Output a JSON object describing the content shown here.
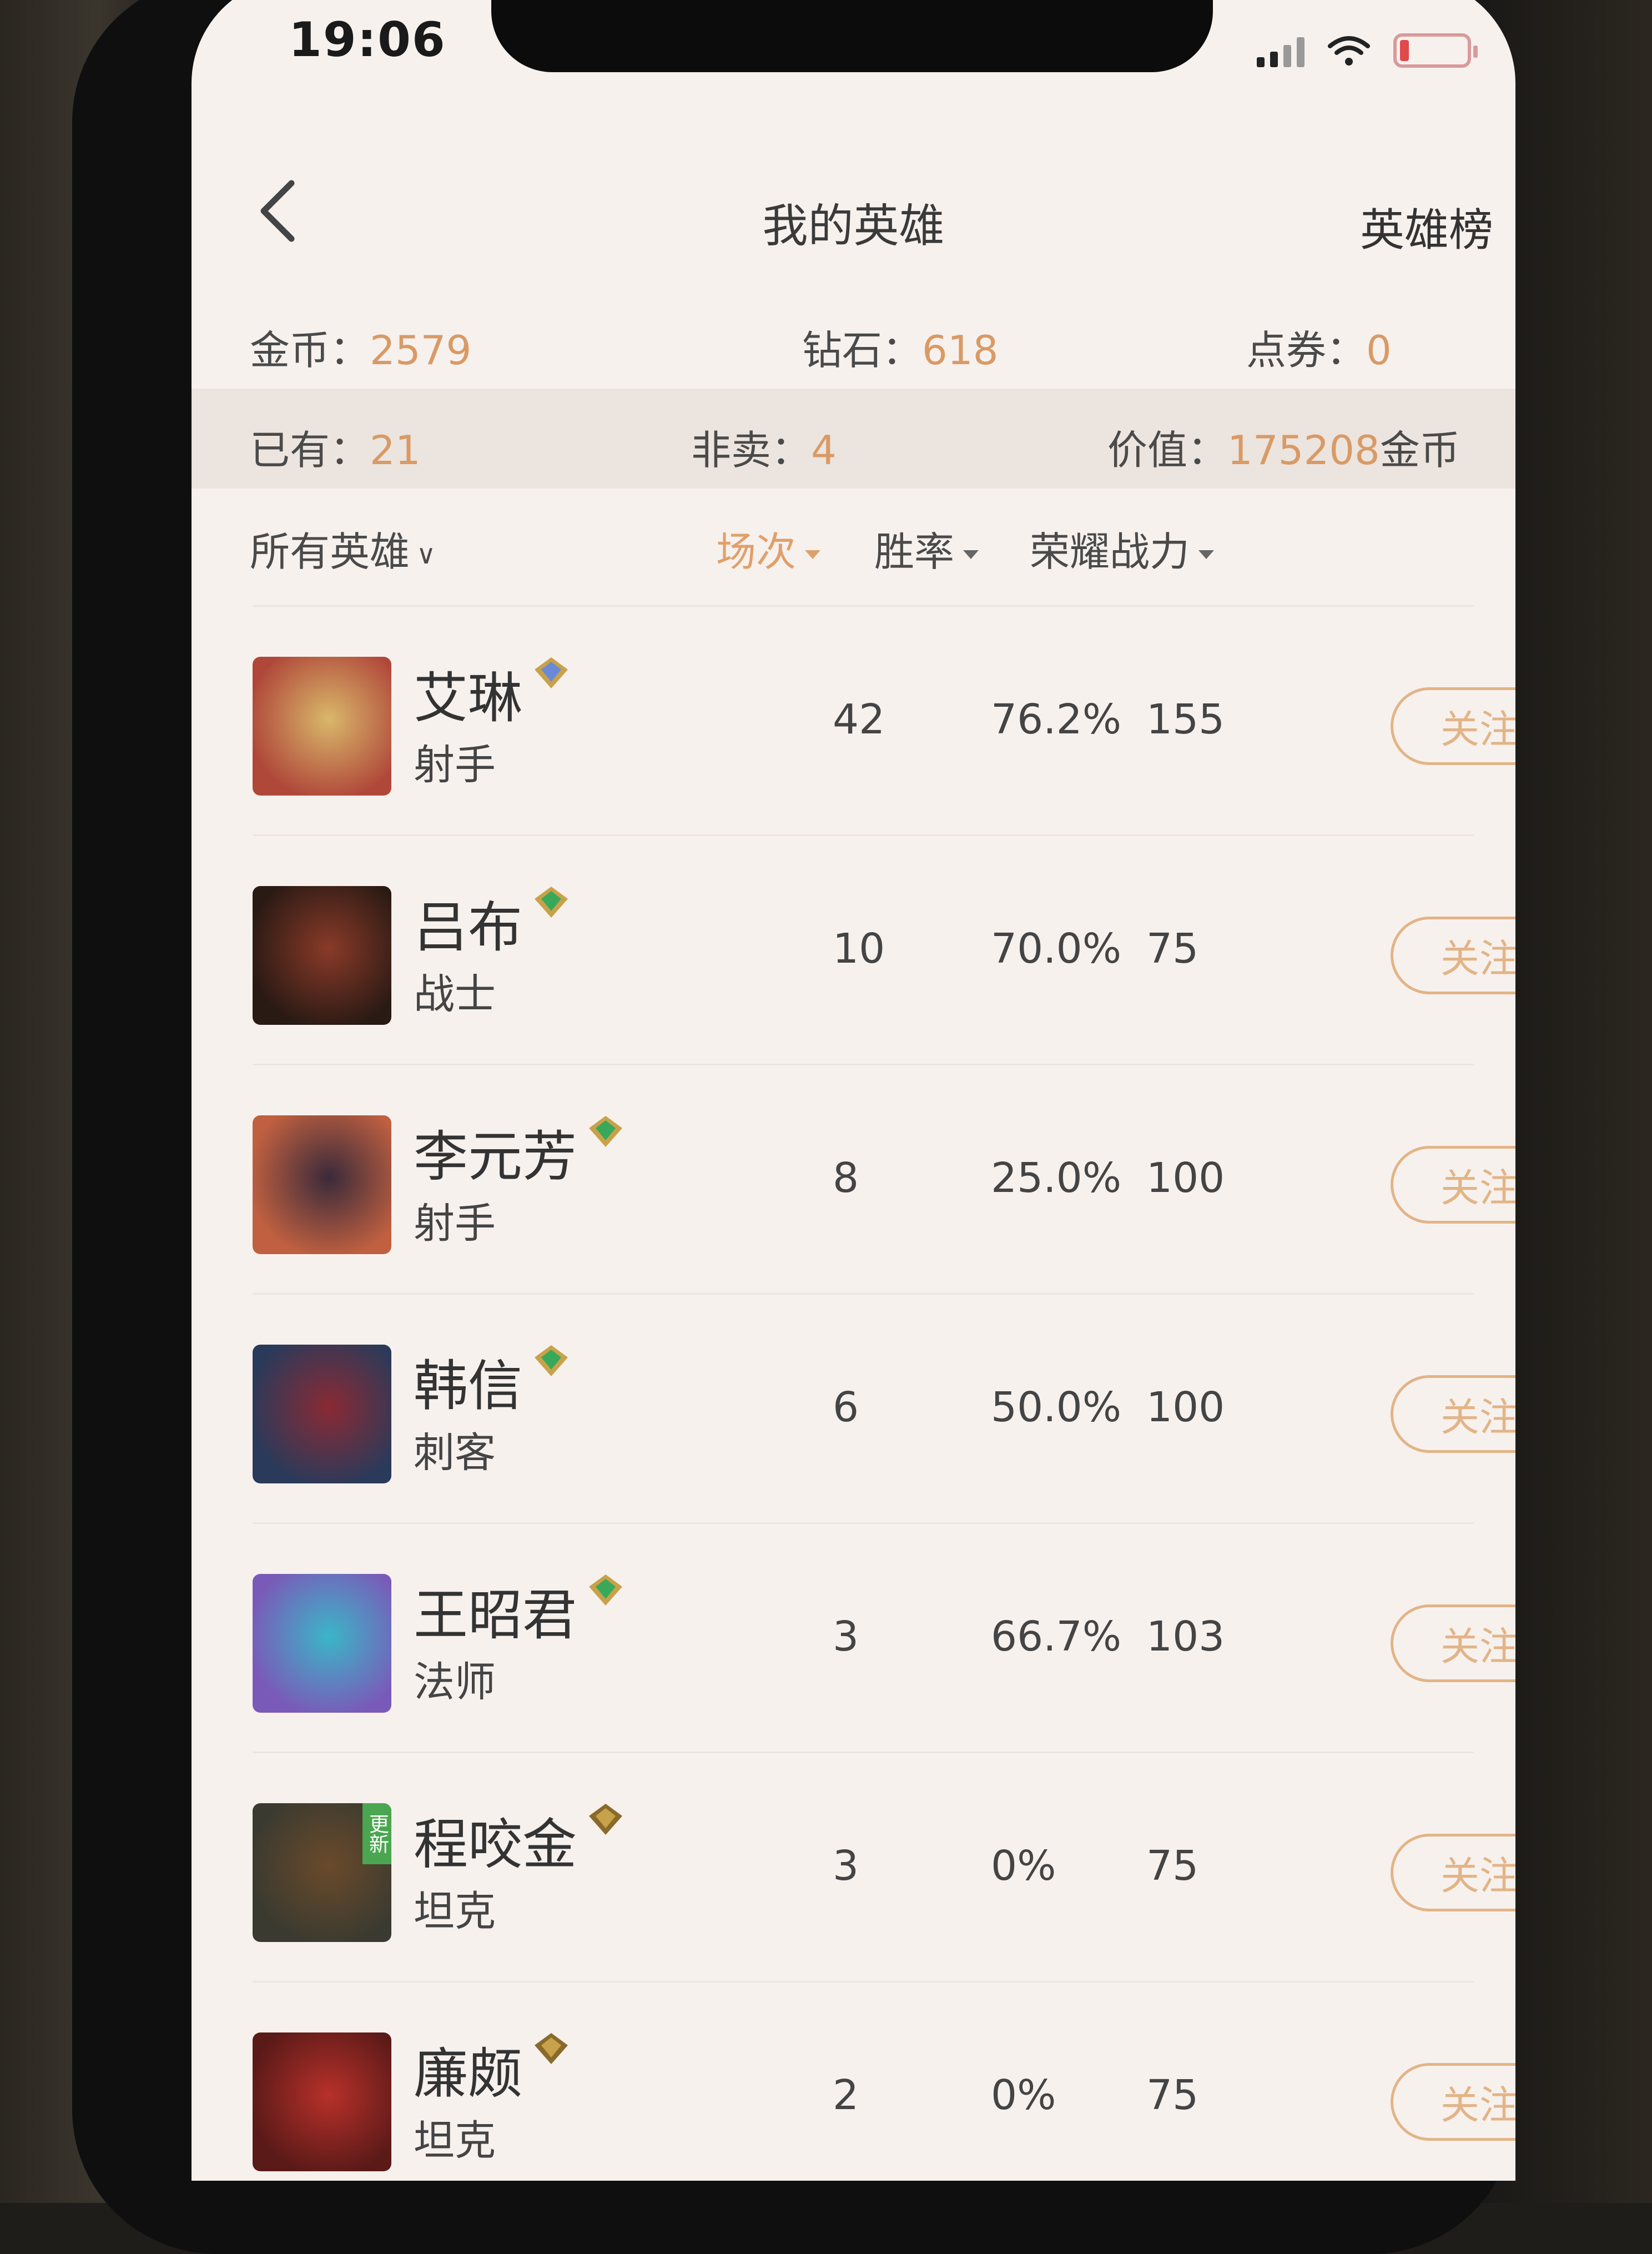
{
  "status": {
    "time": "19:06",
    "battery_color": "#e04a4a"
  },
  "nav": {
    "title": "我的英雄",
    "right_link": "英雄榜"
  },
  "wallet": {
    "gold_label": "金币：",
    "gold_value": "2579",
    "diamond_label": "钻石：",
    "diamond_value": "618",
    "coupon_label": "点券：",
    "coupon_value": "0"
  },
  "summary": {
    "owned_label": "已有：",
    "owned_value": "21",
    "not_for_sale_label": "非卖：",
    "not_for_sale_value": "4",
    "worth_label": "价值：",
    "worth_value": "175208",
    "worth_unit": "金币"
  },
  "sort": {
    "filter_label": "所有英雄",
    "games_label": "场次",
    "winrate_label": "胜率",
    "power_label": "荣耀战力"
  },
  "colors": {
    "accent": "#e0a06a",
    "value": "#d99a66",
    "follow_border": "#e2b486"
  },
  "heroes": [
    {
      "name": "艾琳",
      "role": "射手",
      "games": "42",
      "winrate": "76.2%",
      "power": "155",
      "follow": "关注",
      "gem": "blue-gem-icon",
      "avatar_colors": [
        "#d9b86a",
        "#b0483a"
      ]
    },
    {
      "name": "吕布",
      "role": "战士",
      "games": "10",
      "winrate": "70.0%",
      "power": "75",
      "follow": "关注",
      "gem": "green-gem-icon",
      "avatar_colors": [
        "#8a3a28",
        "#2a1a14"
      ]
    },
    {
      "name": "李元芳",
      "role": "射手",
      "games": "8",
      "winrate": "25.0%",
      "power": "100",
      "follow": "关注",
      "gem": "green-gem-icon",
      "avatar_colors": [
        "#3a2a3a",
        "#c06040"
      ]
    },
    {
      "name": "韩信",
      "role": "刺客",
      "games": "6",
      "winrate": "50.0%",
      "power": "100",
      "follow": "关注",
      "gem": "green-gem-icon",
      "avatar_colors": [
        "#8a2a34",
        "#2a3a5a"
      ]
    },
    {
      "name": "王昭君",
      "role": "法师",
      "games": "3",
      "winrate": "66.7%",
      "power": "103",
      "follow": "关注",
      "gem": "green-gem-icon",
      "avatar_colors": [
        "#3ab6c8",
        "#7a5ab8"
      ]
    },
    {
      "name": "程咬金",
      "role": "坦克",
      "games": "3",
      "winrate": "0%",
      "power": "75",
      "follow": "关注",
      "gem": "gold-gem-icon",
      "avatar_colors": [
        "#6a4a2a",
        "#3a3a30"
      ],
      "tag": "更新"
    },
    {
      "name": "廉颇",
      "role": "坦克",
      "games": "2",
      "winrate": "0%",
      "power": "75",
      "follow": "关注",
      "gem": "gold-gem-icon",
      "avatar_colors": [
        "#b8302a",
        "#5a1a18"
      ]
    }
  ]
}
